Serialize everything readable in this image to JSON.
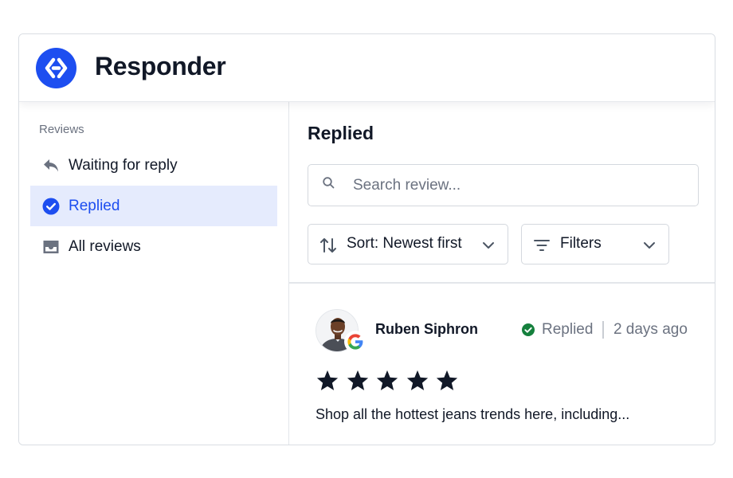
{
  "app": {
    "title": "Responder",
    "brand_color": "#1d4ef0"
  },
  "sidebar": {
    "heading": "Reviews",
    "items": [
      {
        "label": "Waiting for reply",
        "icon": "reply-icon",
        "active": false
      },
      {
        "label": "Replied",
        "icon": "check-circle-icon",
        "active": true
      },
      {
        "label": "All reviews",
        "icon": "inbox-icon",
        "active": false
      }
    ]
  },
  "main": {
    "title": "Replied",
    "search": {
      "placeholder": "Search review...",
      "value": ""
    },
    "sort": {
      "label": "Sort: Newest first",
      "icon": "sort-arrows-icon"
    },
    "filters": {
      "label": "Filters",
      "icon": "filter-lines-icon"
    }
  },
  "review": {
    "reviewer": "Ruben Siphron",
    "source_icon": "google-icon",
    "status": "Replied",
    "status_color": "#15803d",
    "time": "2 days ago",
    "rating": 5,
    "text": "Shop all the hottest jeans trends here, including..."
  }
}
